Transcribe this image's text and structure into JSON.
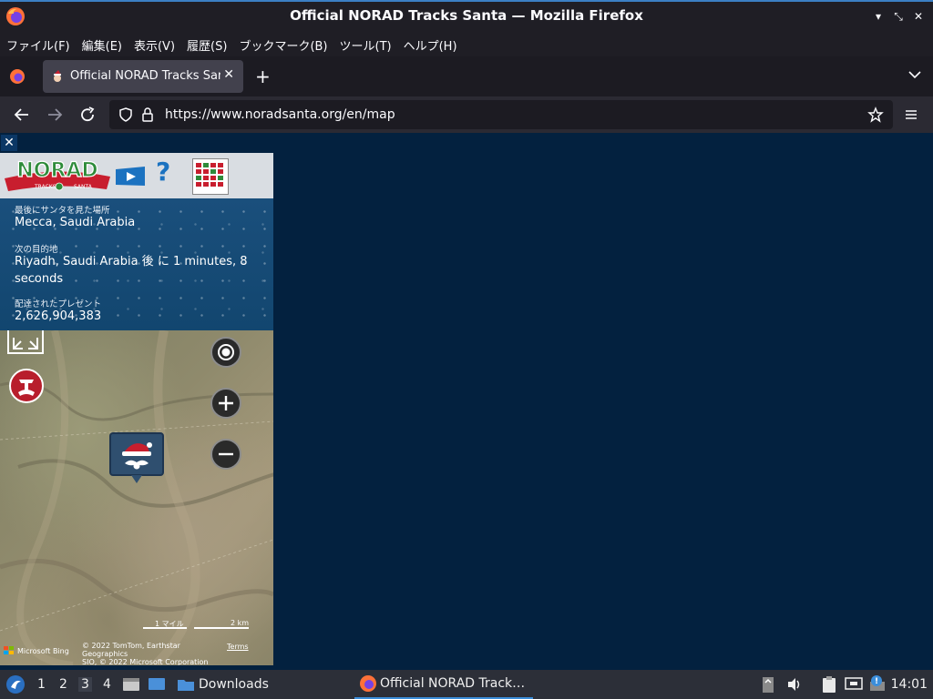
{
  "window": {
    "title": "Official NORAD Tracks Santa — Mozilla Firefox"
  },
  "menu": [
    "ファイル(F)",
    "編集(E)",
    "表示(V)",
    "履歴(S)",
    "ブックマーク(B)",
    "ツール(T)",
    "ヘルプ(H)"
  ],
  "tab": {
    "title": "Official NORAD Tracks Santa",
    "close": "✕"
  },
  "newtab": "+",
  "url": "https://www.noradsanta.org/en/map",
  "panel": {
    "close": "✕",
    "help": "?",
    "last_seen_label": "最後にサンタを見た場所",
    "last_seen_value": "Mecca, Saudi Arabia",
    "next_label": "次の目的地",
    "next_value": "Riyadh, Saudi Arabia 後 に 1 minutes, 8 seconds",
    "gifts_label": "配達されたプレゼント",
    "gifts_value": "2,626,904,383"
  },
  "map": {
    "scale_mi": "1 マイル",
    "scale_km": "2 km",
    "attribution_line1": "© 2022 TomTom, Earthstar Geographics",
    "attribution_line2": "SIO, © 2022 Microsoft Corporation",
    "terms": "Terms",
    "bing": "Microsoft Bing"
  },
  "taskbar": {
    "workspaces": [
      "1",
      "2",
      "3",
      "4"
    ],
    "folder": "Downloads",
    "app": "Official NORAD Track…",
    "clock": "14:01"
  }
}
